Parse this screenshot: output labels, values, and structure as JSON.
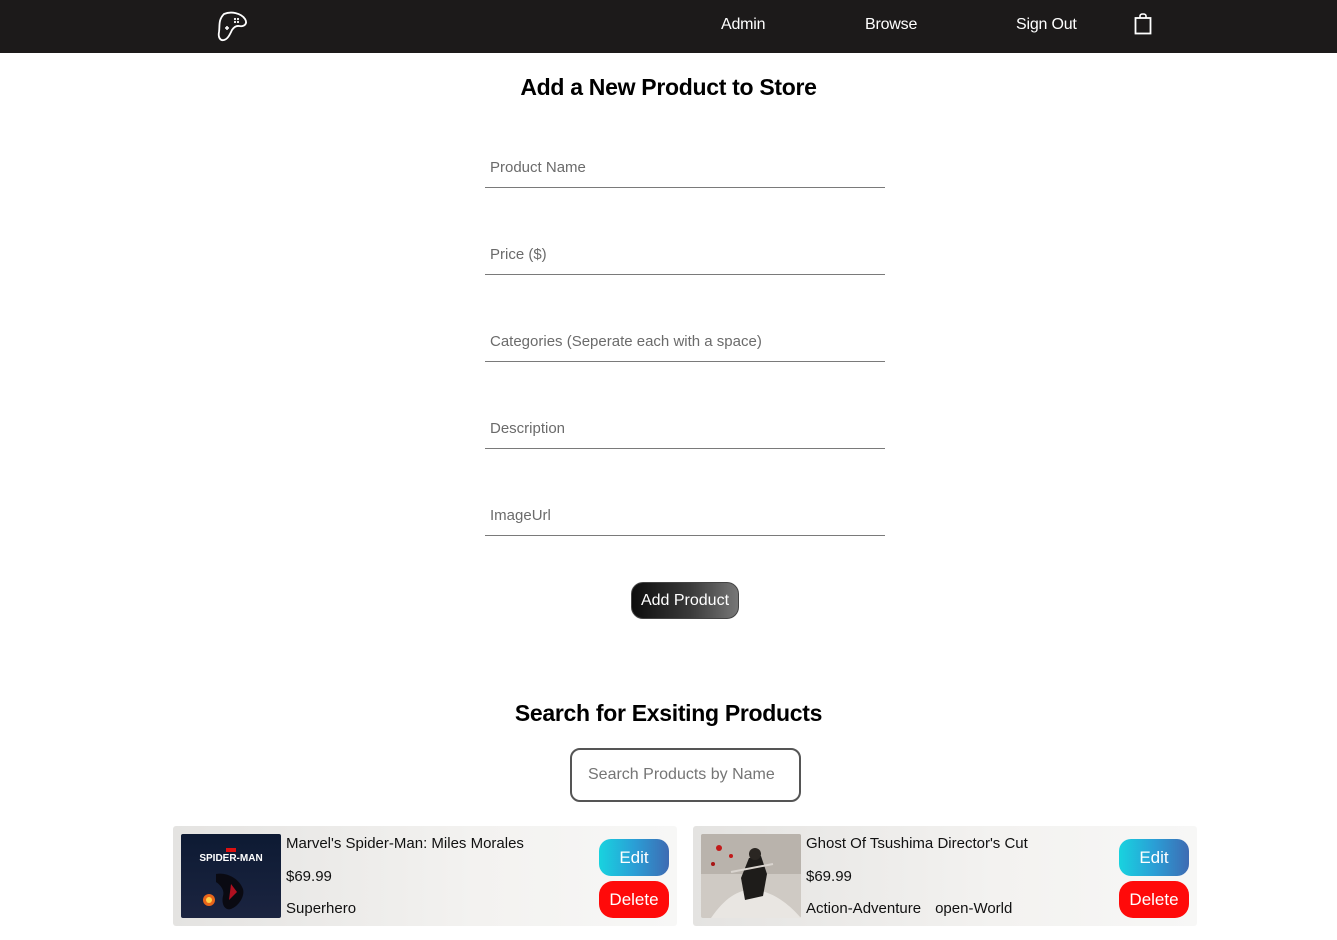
{
  "nav": {
    "logo_icon": "gamepad-icon",
    "links": [
      "Admin",
      "Browse",
      "Sign Out"
    ],
    "cart_icon": "shopping-bag-icon"
  },
  "add_form": {
    "title": "Add a New Product to Store",
    "fields": [
      {
        "placeholder": "Product Name",
        "value": ""
      },
      {
        "placeholder": "Price ($)",
        "value": ""
      },
      {
        "placeholder": "Categories (Seperate each with a space)",
        "value": ""
      },
      {
        "placeholder": "Description",
        "value": ""
      },
      {
        "placeholder": "ImageUrl",
        "value": ""
      }
    ],
    "submit_label": "Add Product"
  },
  "search": {
    "title": "Search for Exsiting Products",
    "placeholder": "Search Products by Name",
    "value": ""
  },
  "products": [
    {
      "name": "Marvel's Spider-Man: Miles Morales",
      "price": "$69.99",
      "categories": [
        "Superhero"
      ],
      "thumb_text": "SPIDER-MAN",
      "edit_label": "Edit",
      "delete_label": "Delete"
    },
    {
      "name": "Ghost Of Tsushima Director's Cut",
      "price": "$69.99",
      "categories": [
        "Action-Adventure",
        "open-World"
      ],
      "edit_label": "Edit",
      "delete_label": "Delete"
    }
  ],
  "colors": {
    "navbar": "#1c1a1a",
    "edit_gradient_start": "#18d3df",
    "edit_gradient_end": "#3e6bb3",
    "delete": "#ff0a0a"
  }
}
